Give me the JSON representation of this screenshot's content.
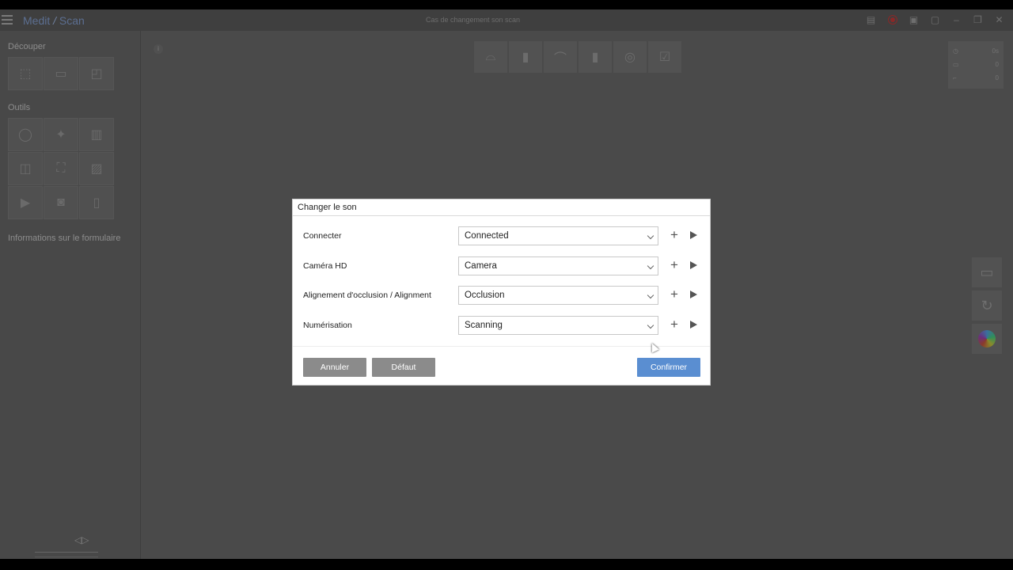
{
  "app": {
    "name_prefix": "Medit",
    "name_slash": " / ",
    "name_suffix": "Scan",
    "window_title": "Cas de changement son scan"
  },
  "sidebar": {
    "decouper_title": "Découper",
    "outils_title": "Outils",
    "form_info": "Informations sur le formulaire"
  },
  "info_glyph": "i",
  "dialog": {
    "title": "Changer le son",
    "rows": [
      {
        "label": "Connecter",
        "value": "Connected"
      },
      {
        "label": "Caméra HD",
        "value": "Camera"
      },
      {
        "label": "Alignement d'occlusion / Alignment",
        "value": "Occlusion"
      },
      {
        "label": "Numérisation",
        "value": "Scanning"
      }
    ],
    "cancel_label": "Annuler",
    "default_label": "Défaut",
    "confirm_label": "Confirmer"
  },
  "stats": [
    "0s",
    "0",
    "0"
  ],
  "colors": {
    "confirm": "#5a8ed1",
    "secondary": "#8b8b8b",
    "record": "#8a2828"
  }
}
